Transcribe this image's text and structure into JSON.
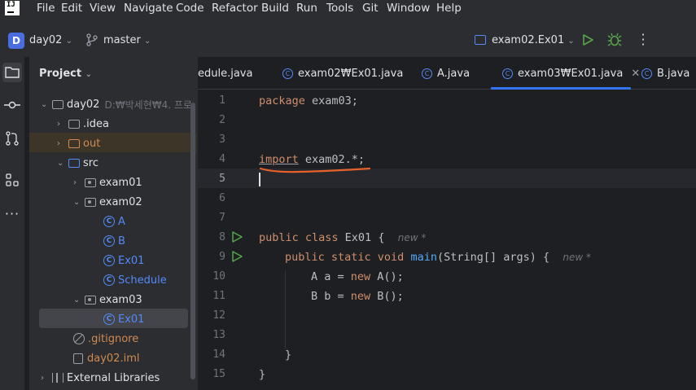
{
  "menu": [
    "File",
    "Edit",
    "View",
    "Navigate",
    "Code",
    "Refactor",
    "Build",
    "Run",
    "Tools",
    "Git",
    "Window",
    "Help"
  ],
  "toolbar": {
    "project_badge": "D",
    "project_name": "day02",
    "branch": "master",
    "run_config": "exam02.Ex01"
  },
  "project_panel": {
    "title": "Project",
    "root": {
      "name": "day02",
      "path": "D:₩박세현₩4. 프로"
    },
    "items": [
      {
        "label": ".idea"
      },
      {
        "label": "out"
      },
      {
        "label": "src"
      },
      {
        "label": "exam01"
      },
      {
        "label": "exam02"
      },
      {
        "label": "A"
      },
      {
        "label": "B"
      },
      {
        "label": "Ex01"
      },
      {
        "label": "Schedule"
      },
      {
        "label": "exam03"
      },
      {
        "label": "Ex01"
      },
      {
        "label": ".gitignore"
      },
      {
        "label": "day02.iml"
      },
      {
        "label": "External Libraries"
      }
    ]
  },
  "tabs": [
    {
      "label": "edule.java"
    },
    {
      "label": "exam02₩Ex01.java"
    },
    {
      "label": "A.java"
    },
    {
      "label": "exam03₩Ex01.java",
      "active": true
    },
    {
      "label": "B.java"
    }
  ],
  "code": {
    "line_numbers": [
      "1",
      "2",
      "3",
      "4",
      "5",
      "6",
      "7",
      "8",
      "9",
      "10",
      "11",
      "12",
      "13",
      "14",
      "15"
    ],
    "l1_kw": "package",
    "l1_rest": " exam03;",
    "l4_kw": "import",
    "l4_rest": " exam02.*;",
    "l8_kw": "public class",
    "l8_rest": " Ex01 {",
    "l8_hint": "new *",
    "l9_kw": "public static void",
    "l9_fn": "main",
    "l9_rest": "(String[] args) {",
    "l9_hint": "new *",
    "l10_a": "A a = ",
    "l10_kw": "new",
    "l10_b": " A();",
    "l11_a": "B b = ",
    "l11_kw": "new",
    "l11_b": " B();",
    "l14": "}",
    "l15": "}"
  },
  "colors": {
    "accent": "#3574f0",
    "annotation": "#e8612a",
    "excluded_folder": "#d08a53",
    "class_icon": "#548af7"
  }
}
